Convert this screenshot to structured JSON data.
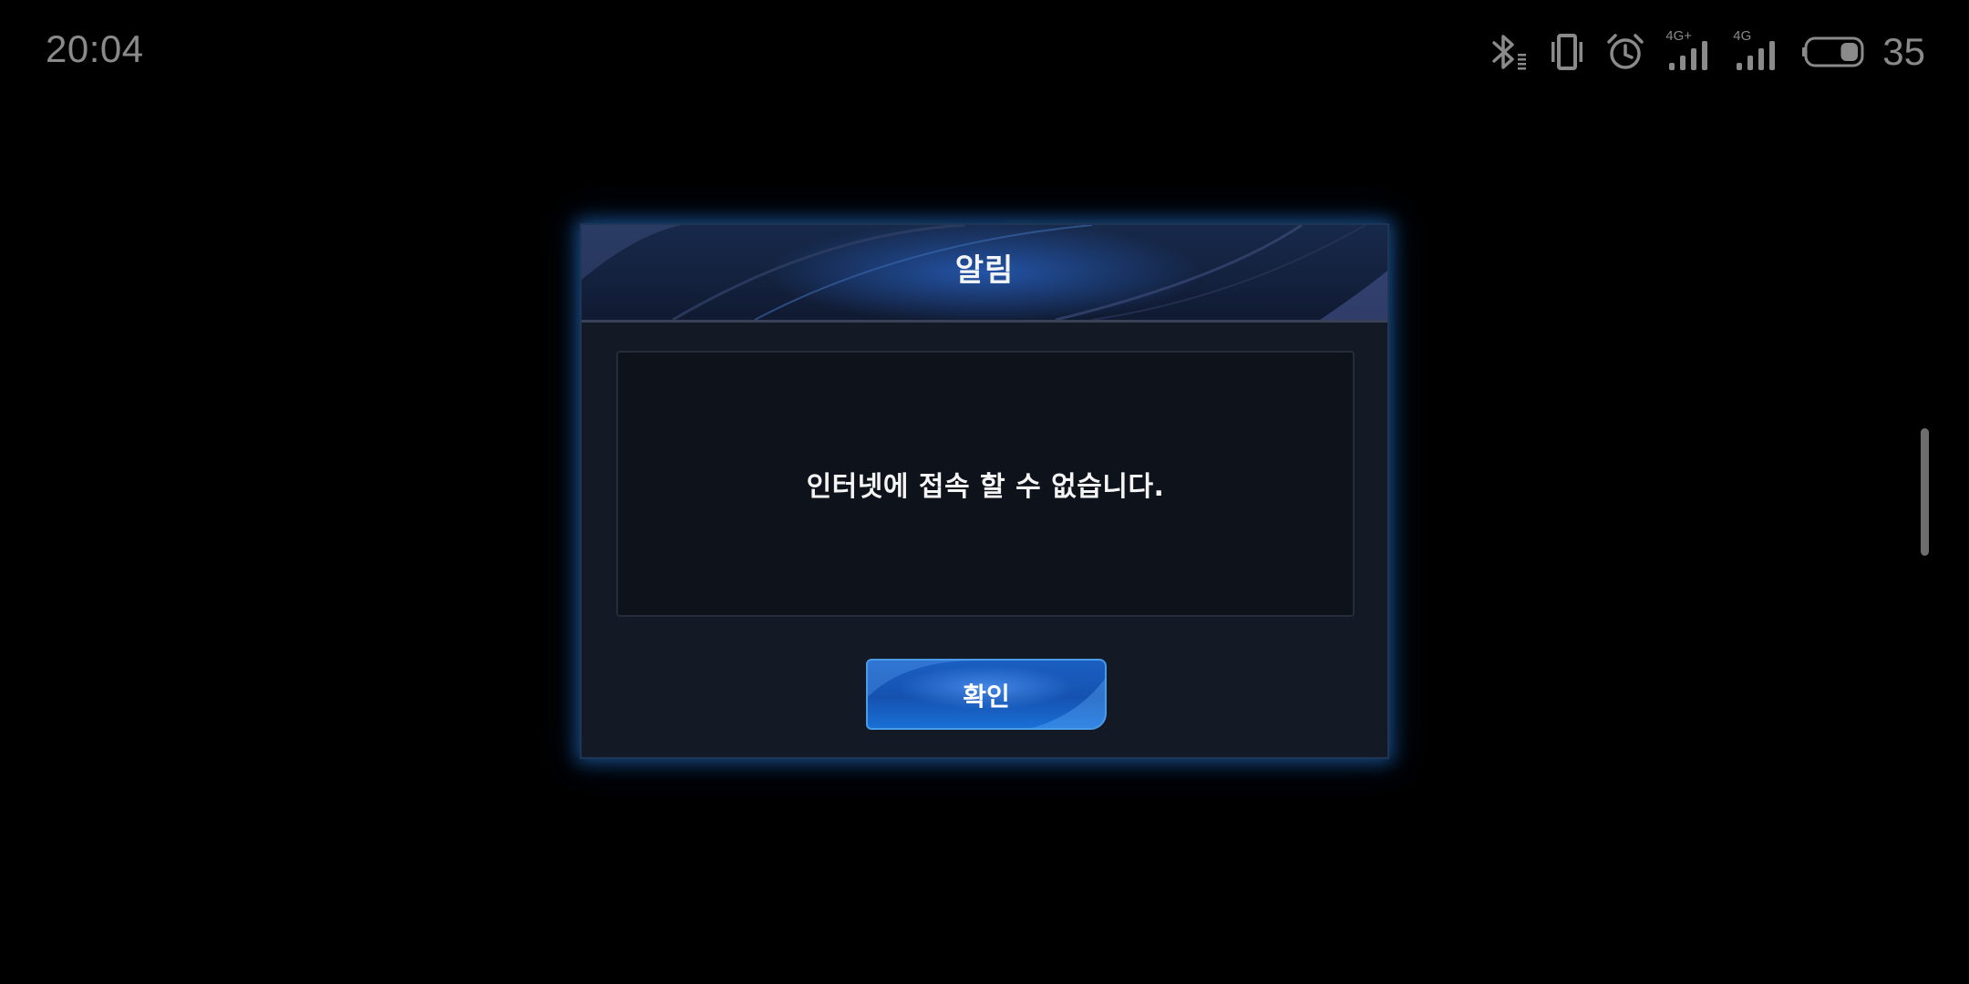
{
  "status_bar": {
    "time": "20:04",
    "network_1_label": "4G+",
    "network_2_label": "4G",
    "battery_level": "35",
    "battery_fill_fraction": 0.35,
    "icon_color": "#8a8a8a"
  },
  "dialog": {
    "title": "알림",
    "message": "인터넷에 접속 할 수 없습니다.",
    "confirm_label": "확인",
    "accent_color": "#1a5fc2",
    "glow_color": "#2878d2"
  }
}
